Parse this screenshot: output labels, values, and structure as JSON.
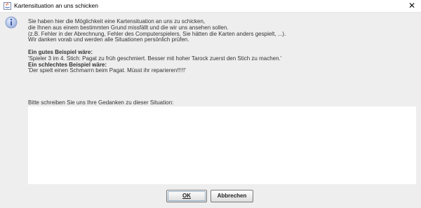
{
  "window": {
    "title": "Kartensituation an uns schicken",
    "close_glyph": "✕"
  },
  "message": {
    "line1": "Sie haben hier die Möglichkeit eine Kartensituation an uns zu schicken,",
    "line2": "die Ihnen aus einem bestimmten Grund missfällt und die wir uns ansehen sollen.",
    "line3": "(z.B. Fehler in der Abrechnung, Fehler des Computerspielers, Sie hätten die Karten anders gespielt, ...).",
    "line4": "Wir danken vorab und werden alle Situationen persönlich prüfen.",
    "good_heading": "Ein gutes Beispiel wäre:",
    "good_example": "'Spieler 3 im 4. Stich: Pagat zu früh geschmiert. Besser mit hoher Tarock zuerst den Stich zu machen.'",
    "bad_heading": "Ein schlechtes Beispiel wäre:",
    "bad_example": "'Der spielt einen Schmarrn beim Pagat. Müsst ihr reparieren!!!!!'"
  },
  "prompt": "Bitte schreiben Sie uns Ihre Gedanken zu dieser Situation:",
  "textarea": {
    "value": ""
  },
  "buttons": {
    "ok": "OK",
    "cancel": "Abbrechen"
  },
  "icons": {
    "app": "java-app-icon",
    "info": "info-icon",
    "close": "close-icon"
  },
  "colors": {
    "dialog_bg": "#eeeeee",
    "info_icon_fill": "#b7c6e8",
    "info_icon_text": "#3a56a8"
  }
}
